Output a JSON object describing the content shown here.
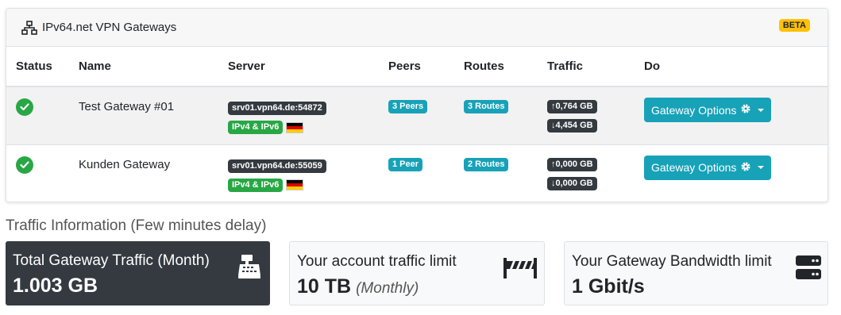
{
  "card": {
    "title": "IPv64.net VPN Gateways",
    "badge": "BETA",
    "icon": "network-icon"
  },
  "table": {
    "headers": [
      "Status",
      "Name",
      "Server",
      "Peers",
      "Routes",
      "Traffic",
      "Do"
    ],
    "rows": [
      {
        "status": "ok",
        "name": "Test Gateway #01",
        "server": "srv01.vpn64.de:54872",
        "ip_version": "IPv4 & IPv6",
        "flag": "germany-flag",
        "peers": "3 Peers",
        "routes": "3 Routes",
        "traffic_up": "0,764 GB",
        "traffic_down": "4,454 GB",
        "action": "Gateway Options"
      },
      {
        "status": "ok",
        "name": "Kunden Gateway",
        "server": "srv01.vpn64.de:55059",
        "ip_version": "IPv4 & IPv6",
        "flag": "germany-flag",
        "peers": "1 Peer",
        "routes": "2 Routes",
        "traffic_up": "0,000 GB",
        "traffic_down": "0,000 GB",
        "action": "Gateway Options"
      }
    ]
  },
  "traffic_info": {
    "title": "Traffic Information (Few minutes delay)",
    "boxes": [
      {
        "label": "Total Gateway Traffic (Month)",
        "value": "1.003 GB",
        "sub": "",
        "icon": "cash-register-icon"
      },
      {
        "label": "Your account traffic limit",
        "value": "10 TB",
        "sub": "(Monthly)",
        "icon": "road-barrier-icon"
      },
      {
        "label": "Your Gateway Bandwidth limit",
        "value": "1 Gbit/s",
        "sub": "",
        "icon": "server-icon"
      }
    ]
  },
  "colors": {
    "success": "#28a745",
    "info": "#17a2b8",
    "dark": "#343a40",
    "warning": "#ffc107"
  }
}
